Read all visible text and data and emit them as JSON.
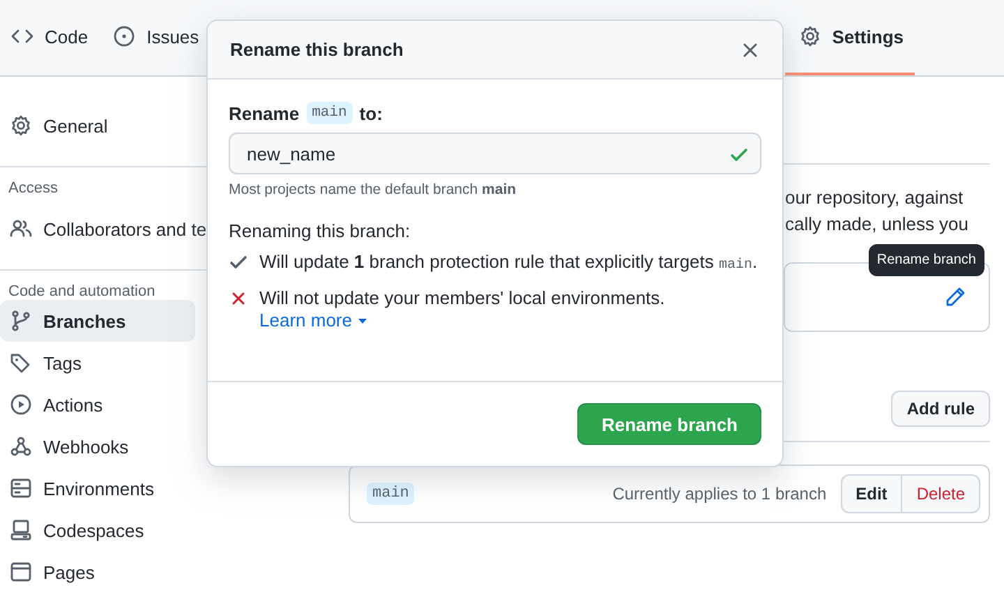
{
  "repo_nav": {
    "tabs": [
      {
        "label": "Code",
        "selected": false
      },
      {
        "label": "Issues",
        "selected": false
      },
      {
        "label": "Settings",
        "selected": true
      }
    ]
  },
  "sidebar": {
    "items": [
      {
        "kind": "item",
        "label": "General",
        "selected": false
      },
      {
        "kind": "heading",
        "label": "Access"
      },
      {
        "kind": "item",
        "label": "Collaborators and te",
        "selected": false
      },
      {
        "kind": "heading",
        "label": "Code and automation"
      },
      {
        "kind": "item",
        "label": "Branches",
        "selected": true
      },
      {
        "kind": "item",
        "label": "Tags",
        "selected": false
      },
      {
        "kind": "item",
        "label": "Actions",
        "selected": false
      },
      {
        "kind": "item",
        "label": "Webhooks",
        "selected": false
      },
      {
        "kind": "item",
        "label": "Environments",
        "selected": false
      },
      {
        "kind": "item",
        "label": "Codespaces",
        "selected": false
      },
      {
        "kind": "item",
        "label": "Pages",
        "selected": false
      }
    ]
  },
  "main": {
    "description_lines": [
      "our repository, against",
      "cally made, unless you"
    ],
    "tooltip": "Rename branch",
    "add_rule_button": "Add rule",
    "rules": [
      {
        "pattern": "main",
        "status": "Currently applies to 1 branch",
        "edit": "Edit",
        "delete": "Delete"
      }
    ]
  },
  "dialog": {
    "title": "Rename this branch",
    "label_prefix": "Rename",
    "label_code": "main",
    "label_suffix": "to:",
    "input": {
      "value": "new_name",
      "valid": true
    },
    "hint": "Most projects name the default branch **main**",
    "section_title": "Renaming this branch:",
    "effects": [
      {
        "kind": "ok",
        "text": "Will update **1** branch protection rule that explicitly targets",
        "code": "main",
        "end": "."
      },
      {
        "kind": "fail",
        "text": "Will not update your members' local environments."
      }
    ],
    "learn_more": "Learn more",
    "submit": "Rename branch"
  }
}
